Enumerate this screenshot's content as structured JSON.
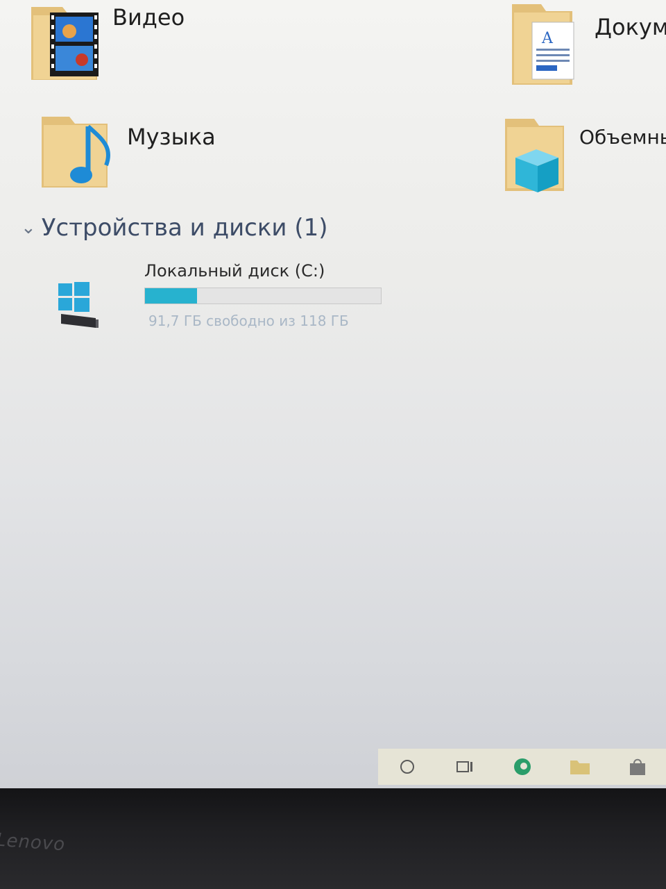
{
  "folders": [
    {
      "name": "videos",
      "label": "Видео"
    },
    {
      "name": "documents",
      "label": "Докуме"
    },
    {
      "name": "music",
      "label": "Музыка"
    },
    {
      "name": "3d-objects",
      "label": "Объемны"
    }
  ],
  "devices_section": {
    "title": "Устройства и диски (1)"
  },
  "drive": {
    "label": "Локальный диск (C:)",
    "free_text": "91,7 ГБ свободно из 118 ГБ",
    "used_fraction": 0.22,
    "bar_color": "#27b2cf"
  },
  "bezel": {
    "logo": "Lenovo"
  },
  "colors": {
    "folder": "#e6c47c",
    "accent_blue": "#1e8bd6",
    "section_text": "#3d4c67"
  }
}
